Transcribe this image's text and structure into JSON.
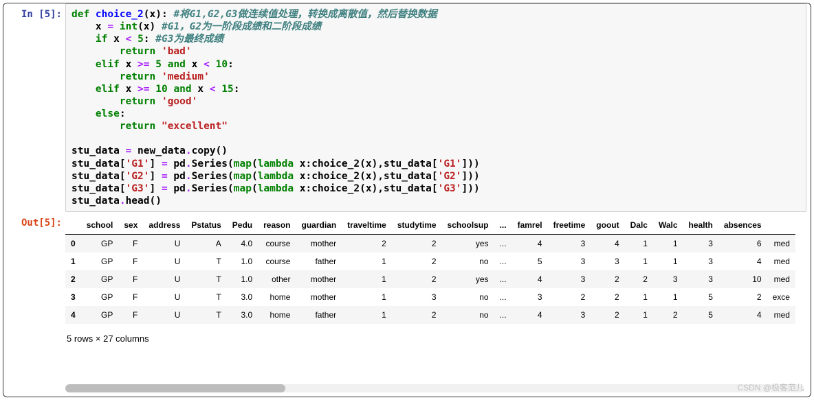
{
  "in_prompt": "In [5]:",
  "out_prompt": "Out[5]:",
  "code": {
    "l1": {
      "def": "def",
      "name": " choice_2",
      "paren": "(x): ",
      "cmt": "#将G1,G2,G3做连续值处理，转换成离散值，然后替换数据"
    },
    "l2": {
      "ind": "    x ",
      "op1": "=",
      "sp1": " ",
      "intfn": "int",
      "par": "(x) ",
      "cmt": "#G1，G2为一阶段成绩和二阶段成绩"
    },
    "l3": {
      "ind": "    ",
      "if": "if",
      "sp": " x ",
      "lt": "<",
      "sp2": " ",
      "n": "5",
      "col": ": ",
      "cmt": "#G3为最终成绩"
    },
    "l4": {
      "ind": "        ",
      "ret": "return",
      "sp": " ",
      "str": "'bad'"
    },
    "l5": {
      "ind": "    ",
      "elif": "elif",
      "sp": " x ",
      "ge": ">=",
      "sp2": " ",
      "n1": "5",
      "sp3": " ",
      "and": "and",
      "sp4": " x ",
      "lt": "<",
      "sp5": " ",
      "n2": "10",
      "col": ":"
    },
    "l6": {
      "ind": "        ",
      "ret": "return",
      "sp": " ",
      "str": "'medium'"
    },
    "l7": {
      "ind": "    ",
      "elif": "elif",
      "sp": " x ",
      "ge": ">=",
      "sp2": " ",
      "n1": "10",
      "sp3": " ",
      "and": "and",
      "sp4": " x ",
      "lt": "<",
      "sp5": " ",
      "n2": "15",
      "col": ":"
    },
    "l8": {
      "ind": "        ",
      "ret": "return",
      "sp": " ",
      "str": "'good'"
    },
    "l9": {
      "ind": "    ",
      "else": "else",
      "col": ":"
    },
    "l10": {
      "ind": "        ",
      "ret": "return",
      "sp": " ",
      "str": "\"excellent\""
    },
    "blank": " ",
    "l12": {
      "t1": "stu_data ",
      "eq": "=",
      "t2": " new_data",
      "dot": ".",
      "copy": "copy()"
    },
    "l13": {
      "t1": "stu_data[",
      "k": "'G1'",
      "t2": "] ",
      "eq": "=",
      "t3": " pd",
      "dot": ".",
      "t4": "Series(",
      "map": "map",
      "t5": "(",
      "lamb": "lambda",
      "t6": " x:choice_2(x),stu_data[",
      "k2": "'G1'",
      "t7": "]))"
    },
    "l14": {
      "t1": "stu_data[",
      "k": "'G2'",
      "t2": "] ",
      "eq": "=",
      "t3": " pd",
      "dot": ".",
      "t4": "Series(",
      "map": "map",
      "t5": "(",
      "lamb": "lambda",
      "t6": " x:choice_2(x),stu_data[",
      "k2": "'G2'",
      "t7": "]))"
    },
    "l15": {
      "t1": "stu_data[",
      "k": "'G3'",
      "t2": "] ",
      "eq": "=",
      "t3": " pd",
      "dot": ".",
      "t4": "Series(",
      "map": "map",
      "t5": "(",
      "lamb": "lambda",
      "t6": " x:choice_2(x),stu_data[",
      "k2": "'G3'",
      "t7": "]))"
    },
    "l16": {
      "t1": "stu_data",
      "dot": ".",
      "t2": "head()"
    }
  },
  "df": {
    "headers": [
      "school",
      "sex",
      "address",
      "Pstatus",
      "Pedu",
      "reason",
      "guardian",
      "traveltime",
      "studytime",
      "schoolsup",
      "...",
      "famrel",
      "freetime",
      "goout",
      "Dalc",
      "Walc",
      "health",
      "absences",
      ""
    ],
    "rows": [
      {
        "idx": "0",
        "cells": [
          "GP",
          "F",
          "U",
          "A",
          "4.0",
          "course",
          "mother",
          "2",
          "2",
          "yes",
          "...",
          "4",
          "3",
          "4",
          "1",
          "1",
          "3",
          "6",
          "med"
        ]
      },
      {
        "idx": "1",
        "cells": [
          "GP",
          "F",
          "U",
          "T",
          "1.0",
          "course",
          "father",
          "1",
          "2",
          "no",
          "...",
          "5",
          "3",
          "3",
          "1",
          "1",
          "3",
          "4",
          "med"
        ]
      },
      {
        "idx": "2",
        "cells": [
          "GP",
          "F",
          "U",
          "T",
          "1.0",
          "other",
          "mother",
          "1",
          "2",
          "yes",
          "...",
          "4",
          "3",
          "2",
          "2",
          "3",
          "3",
          "10",
          "med"
        ]
      },
      {
        "idx": "3",
        "cells": [
          "GP",
          "F",
          "U",
          "T",
          "3.0",
          "home",
          "mother",
          "1",
          "3",
          "no",
          "...",
          "3",
          "2",
          "2",
          "1",
          "1",
          "5",
          "2",
          "exce"
        ]
      },
      {
        "idx": "4",
        "cells": [
          "GP",
          "F",
          "U",
          "T",
          "3.0",
          "home",
          "father",
          "1",
          "2",
          "no",
          "...",
          "4",
          "3",
          "2",
          "1",
          "2",
          "5",
          "4",
          "med"
        ]
      }
    ],
    "summary": "5 rows × 27 columns"
  },
  "watermark": "CSDN @极客范儿"
}
